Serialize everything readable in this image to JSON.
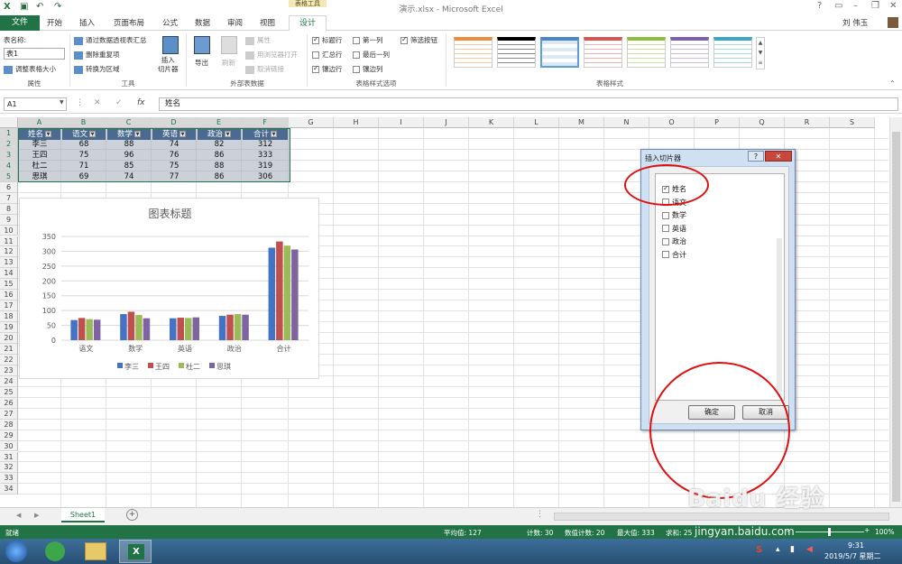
{
  "window": {
    "title": "演示.xlsx - Microsoft Excel",
    "context_tab": "表格工具",
    "user": "刘 伟玉"
  },
  "tabs": [
    "文件",
    "开始",
    "插入",
    "页面布局",
    "公式",
    "数据",
    "审阅",
    "视图",
    "设计"
  ],
  "ribbon": {
    "table_name_label": "表名称:",
    "table_name_value": "表1",
    "resize_table": "调整表格大小",
    "group_properties": "属性",
    "summarize_pivot": "通过数据透视表汇总",
    "remove_duplicates": "删除重复项",
    "convert_range": "转换为区域",
    "group_tools": "工具",
    "insert_slicer": "插入\n切片器",
    "export": "导出",
    "refresh": "刷新",
    "properties": "属性",
    "open_browser": "用浏览器打开",
    "unlink": "取消链接",
    "group_external": "外部表数据",
    "opt_header_row": "标题行",
    "opt_total_row": "汇总行",
    "opt_banded_rows": "镶边行",
    "opt_first_col": "第一列",
    "opt_last_col": "最后一列",
    "opt_banded_cols": "镶边列",
    "opt_filter_btn": "筛选按钮",
    "group_style_options": "表格样式选项",
    "group_styles": "表格样式"
  },
  "formula_bar": {
    "name_box": "A1",
    "fx": "fx",
    "value": "姓名"
  },
  "columns": [
    "A",
    "B",
    "C",
    "D",
    "E",
    "F",
    "G",
    "H",
    "I",
    "J",
    "K",
    "L",
    "M",
    "N",
    "O",
    "P",
    "Q",
    "R",
    "S"
  ],
  "rows": [
    "1",
    "2",
    "3",
    "4",
    "5",
    "6",
    "7",
    "8",
    "9",
    "10",
    "11",
    "12",
    "13",
    "14",
    "15",
    "16",
    "17",
    "18",
    "19",
    "20",
    "21",
    "22",
    "23",
    "24",
    "25",
    "26",
    "27",
    "28",
    "29",
    "30",
    "31",
    "32",
    "33",
    "34"
  ],
  "table": {
    "headers": [
      "姓名",
      "语文",
      "数学",
      "英语",
      "政治",
      "合计"
    ],
    "rows": [
      [
        "李三",
        "68",
        "88",
        "74",
        "82",
        "312"
      ],
      [
        "王四",
        "75",
        "96",
        "76",
        "86",
        "333"
      ],
      [
        "杜二",
        "71",
        "85",
        "75",
        "88",
        "319"
      ],
      [
        "思琪",
        "69",
        "74",
        "77",
        "86",
        "306"
      ]
    ]
  },
  "chart_data": {
    "type": "bar",
    "title": "图表标题",
    "categories": [
      "语文",
      "数学",
      "英语",
      "政治",
      "合计"
    ],
    "series": [
      {
        "name": "李三",
        "values": [
          68,
          88,
          74,
          82,
          312
        ],
        "color": "#4472c4"
      },
      {
        "name": "王四",
        "values": [
          75,
          96,
          76,
          86,
          333
        ],
        "color": "#c0504d"
      },
      {
        "name": "杜二",
        "values": [
          71,
          85,
          75,
          88,
          319
        ],
        "color": "#9bbb59"
      },
      {
        "name": "思琪",
        "values": [
          69,
          74,
          77,
          86,
          306
        ],
        "color": "#8064a2"
      }
    ],
    "yticks": [
      "0",
      "50",
      "100",
      "150",
      "200",
      "250",
      "300",
      "350"
    ],
    "ylim": [
      0,
      350
    ],
    "legend": "bottom",
    "grid": true
  },
  "dialog": {
    "title": "插入切片器",
    "help": "?",
    "items": [
      {
        "label": "姓名",
        "checked": true
      },
      {
        "label": "语文",
        "checked": false
      },
      {
        "label": "数学",
        "checked": false
      },
      {
        "label": "英语",
        "checked": false
      },
      {
        "label": "政治",
        "checked": false
      },
      {
        "label": "合计",
        "checked": false
      }
    ],
    "ok": "确定",
    "cancel": "取消"
  },
  "sheet": {
    "tab": "Sheet1"
  },
  "status": {
    "ready": "就绪",
    "average": "平均值: 127",
    "count": "计数: 30",
    "numeric_count": "数值计数: 20",
    "max": "最大值: 333",
    "sum": "求和: 25",
    "zoom": "100%"
  },
  "taskbar": {
    "time": "9:31",
    "date": "2019/5/7 星期二"
  },
  "watermark": {
    "text": "Baidu 经验",
    "url": "jingyan.baidu.com"
  },
  "colors": {
    "excel_green": "#217346",
    "table_header": "#4a6b8f",
    "annotation": "#e01010"
  }
}
